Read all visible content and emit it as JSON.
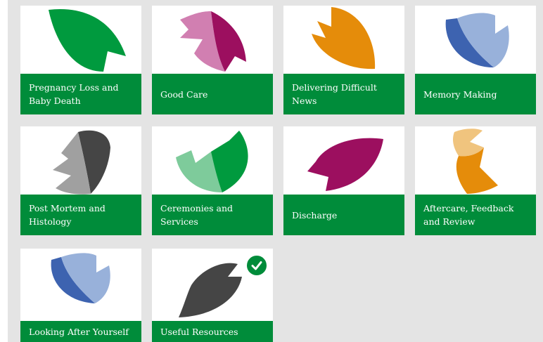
{
  "tiles": [
    {
      "label": "Pregnancy Loss and Baby Death",
      "icon": "green-leaf-icon"
    },
    {
      "label": "Good Care",
      "icon": "pink-magenta-leaf-icon"
    },
    {
      "label": "Delivering Difficult News",
      "icon": "orange-leaf-icon"
    },
    {
      "label": "Memory Making",
      "icon": "blue-leaf-icon"
    },
    {
      "label": "Post Mortem and Histology",
      "icon": "grey-leaf-icon"
    },
    {
      "label": "Ceremonies and Services",
      "icon": "light-green-leaf-icon"
    },
    {
      "label": "Discharge",
      "icon": "magenta-leaf-icon"
    },
    {
      "label": "Aftercare, Feedback and Review",
      "icon": "orange-leaf-icon"
    },
    {
      "label": "Looking After Yourself",
      "icon": "blue-leaf-icon"
    },
    {
      "label": "Useful Resources",
      "icon": "dark-grey-leaf-icon",
      "completed": true
    }
  ],
  "colors": {
    "label_background": "#008c3a",
    "panel_background": "#e4e4e4",
    "green": "#009a3e",
    "light_green": "#7ecb9b",
    "pink": "#d17fb1",
    "magenta": "#9c0f5f",
    "orange": "#e58c0a",
    "light_orange": "#f0c47e",
    "blue": "#3d63b0",
    "light_blue": "#98b1da",
    "grey": "#a0a0a0",
    "dark_grey": "#454545"
  }
}
